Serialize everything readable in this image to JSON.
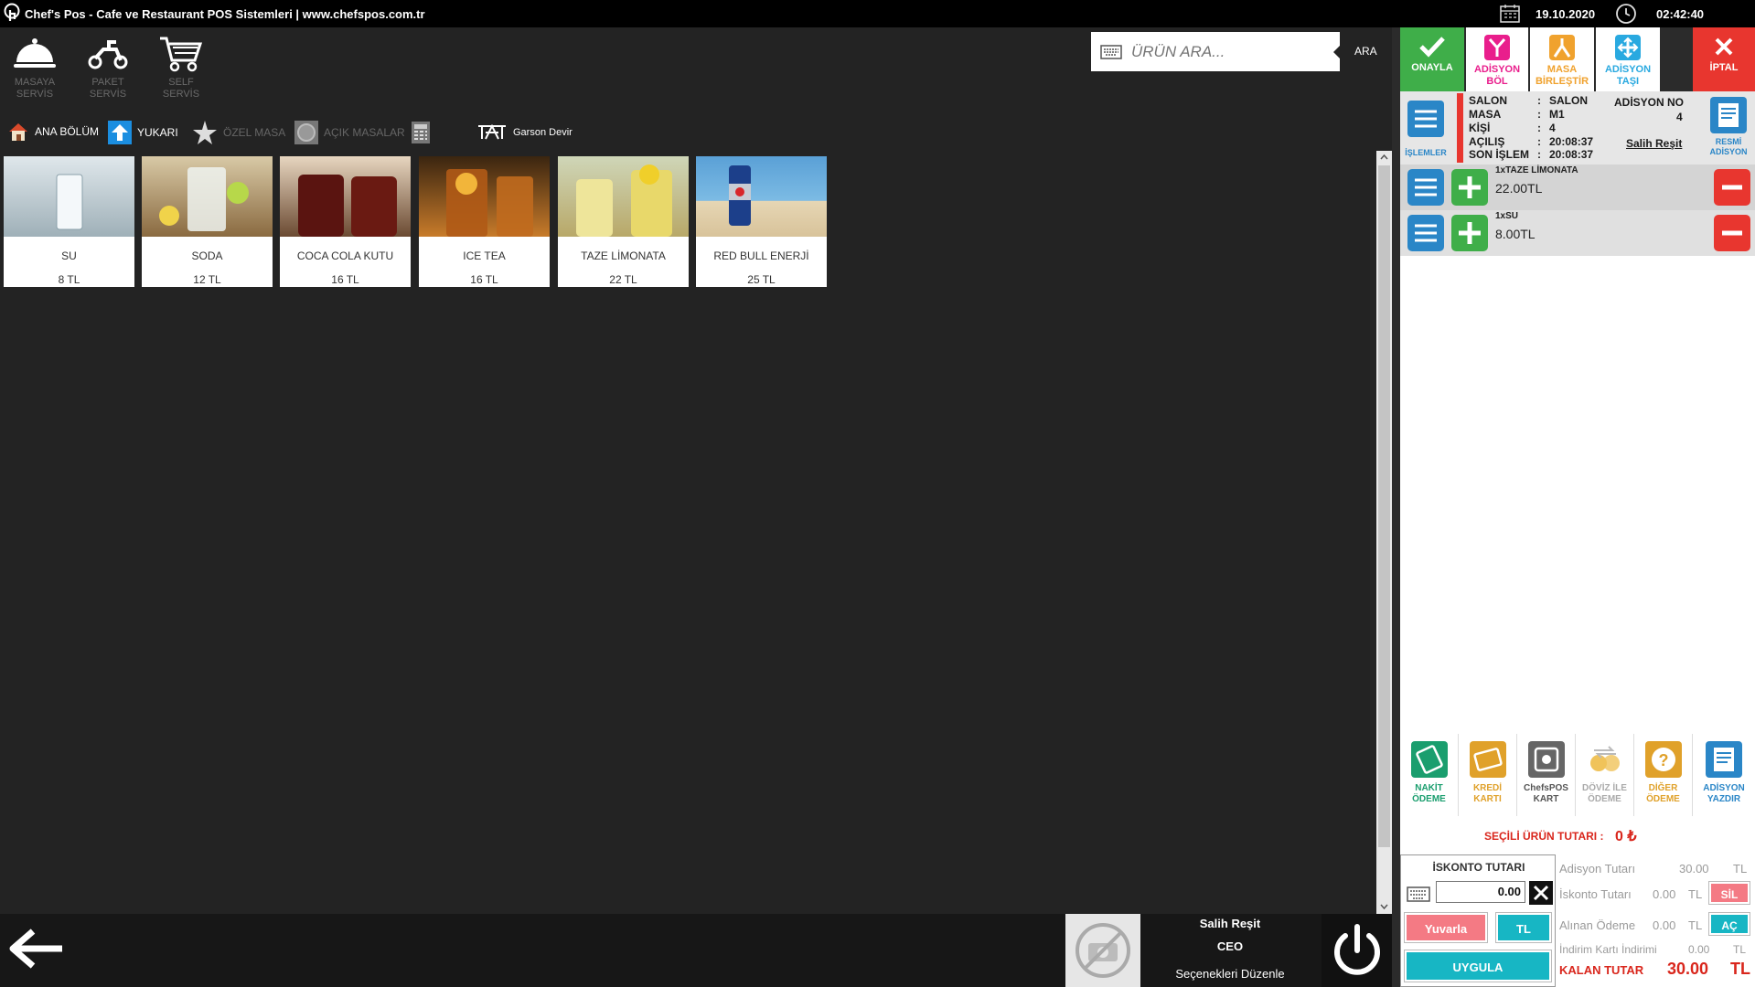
{
  "titlebar": {
    "title": "Chef's Pos - Cafe ve Restaurant POS Sistemleri  |  www.chefspos.com.tr",
    "date": "19.10.2020",
    "time": "02:42:40"
  },
  "service": {
    "items": [
      {
        "label": "MASAYA SERVİS",
        "icon": "cloche-icon"
      },
      {
        "label": "PAKET SERVİS",
        "icon": "scooter-icon"
      },
      {
        "label": "SELF SERVİS",
        "icon": "cart-icon"
      }
    ]
  },
  "search": {
    "placeholder": "ÜRÜN ARA...",
    "button": "ARA"
  },
  "nav": {
    "home": "ANA BÖLÜM",
    "up": "YUKARI",
    "special": "ÖZEL MASA",
    "open": "AÇIK MASALAR",
    "waiter": "Garson Devir"
  },
  "products": [
    {
      "name": "SU",
      "price": "8 TL",
      "color": "#b9c7cf"
    },
    {
      "name": "SODA",
      "price": "12 TL",
      "color": "#c9b38a"
    },
    {
      "name": "COCA COLA KUTU",
      "price": "16 TL",
      "color": "#6b2a1a"
    },
    {
      "name": "ICE TEA",
      "price": "16 TL",
      "color": "#b46a22"
    },
    {
      "name": "TAZE LİMONATA",
      "price": "22 TL",
      "color": "#d7c26a"
    },
    {
      "name": "RED BULL ENERJİ",
      "price": "25 TL",
      "color": "#3f7ea9"
    }
  ],
  "toolbar": {
    "confirm": "ONAYLA",
    "split": "ADİSYON BÖL",
    "merge": "MASA BİRLEŞTİR",
    "move": "ADİSYON TAŞI",
    "cancel": "İPTAL",
    "colors": {
      "confirm": "#3fae49",
      "split": "#e91e8c",
      "merge": "#f0a22e",
      "move": "#29a9e0",
      "cancel": "#e8362f"
    }
  },
  "info": {
    "islemler": "İŞLEMLER",
    "salon_k": "SALON",
    "salon_v": "SALON",
    "masa_k": "MASA",
    "masa_v": "M1",
    "kisi_k": "KİŞİ",
    "kisi_v": "4",
    "acilis_k": "AÇILIŞ",
    "acilis_v": "20:08:37",
    "son_k": "SON İŞLEM",
    "son_v": "20:08:37",
    "colon": ":",
    "adisyon_no_label": "ADİSYON NO",
    "adisyon_no": "4",
    "user": "Salih Reşit",
    "resmi": "RESMİ ADİSYON"
  },
  "order": [
    {
      "title": "1xTAZE LİMONATA",
      "price": "22.00TL"
    },
    {
      "title": "1xSU",
      "price": "8.00TL"
    }
  ],
  "payments": [
    {
      "label": "NAKİT ÖDEME",
      "color": "#1a9e6e",
      "icon": "cash-icon"
    },
    {
      "label": "KREDİ KARTI",
      "color": "#e0a12a",
      "icon": "credit-card-icon"
    },
    {
      "label": "ChefsPOS KART",
      "color": "#666666",
      "icon": "pos-card-icon"
    },
    {
      "label": "DÖVİZ İLE ÖDEME",
      "color": "#bbbbbb",
      "icon": "currency-icon"
    },
    {
      "label": "DİĞER ÖDEME",
      "color": "#e0a12a",
      "icon": "question-icon"
    },
    {
      "label": "ADİSYON YAZDIR",
      "color": "#2a86c7",
      "icon": "print-icon"
    }
  ],
  "selected_total": {
    "label": "SEÇİLİ ÜRÜN TUTARI :",
    "value": "0 ₺"
  },
  "discount": {
    "title": "İSKONTO TUTARI",
    "value": "0.00",
    "round": "Yuvarla",
    "tl": "TL",
    "apply": "UYGULA"
  },
  "summary": {
    "adisyon_label": "Adisyon Tutarı",
    "adisyon_value": "30.00",
    "adisyon_unit": "TL",
    "iskonto_label": "İskonto Tutarı",
    "iskonto_value": "0.00",
    "iskonto_unit": "TL",
    "alinan_label": "Alınan Ödeme",
    "alinan_value": "0.00",
    "alinan_unit": "TL",
    "indirim_label": "İndirim Kartı İndirimi",
    "indirim_value": "0.00",
    "indirim_unit": "TL",
    "kalan_label": "KALAN TUTAR",
    "kalan_value": "30.00",
    "kalan_unit": "TL",
    "sil": "SİL",
    "ac": "AÇ"
  },
  "user": {
    "name": "Salih Reşit",
    "role": "CEO",
    "edit": "Seçenekleri Düzenle"
  }
}
